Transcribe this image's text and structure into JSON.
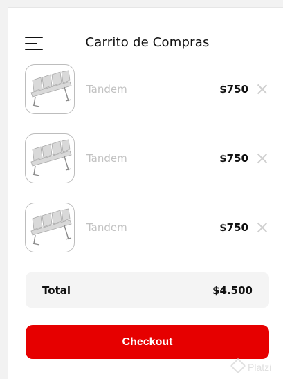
{
  "header": {
    "title": "Carrito de Compras",
    "menu_icon": "hamburger-menu-icon"
  },
  "items": [
    {
      "name": "Tandem",
      "price": "$750",
      "image": "airport-bench-image",
      "remove_icon": "close-icon"
    },
    {
      "name": "Tandem",
      "price": "$750",
      "image": "airport-bench-image",
      "remove_icon": "close-icon"
    },
    {
      "name": "Tandem",
      "price": "$750",
      "image": "airport-bench-image",
      "remove_icon": "close-icon"
    }
  ],
  "summary": {
    "total_label": "Total",
    "total_value": "$4.500"
  },
  "checkout": {
    "label": "Checkout"
  },
  "watermark": {
    "text": "Platzi"
  },
  "colors": {
    "accent": "#e60000",
    "muted_text": "#c2c2c2",
    "summary_bg": "#f4f4f4"
  }
}
